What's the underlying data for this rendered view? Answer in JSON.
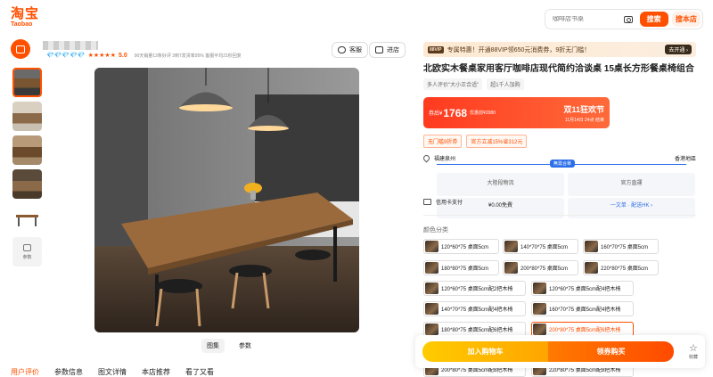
{
  "logo": {
    "cn": "淘宝",
    "en": "Taobao"
  },
  "search": {
    "placeholder": "咖啡店书桌",
    "search_btn": "搜索",
    "store_btn": "搜本店"
  },
  "shop": {
    "diamonds": "💎💎💎💎💎",
    "stars": "★★★★★",
    "score": "5.0",
    "stats": "90天销量13条好评  3到7发货率95%  客服平均21秒回复",
    "service": "客服",
    "enter": "进店"
  },
  "thumbs": {
    "param_label": "参数"
  },
  "image_tabs": [
    "图集",
    "参数"
  ],
  "bottom_tabs": [
    "用户评价",
    "参数信息",
    "图文详情",
    "本店推荐",
    "看了又看"
  ],
  "promo": {
    "vip": "88VIP",
    "text": "专属特惠！开通88VIP领650元消费券，9折无门槛！",
    "go": "去开通 ›"
  },
  "title": "北欧实木餐桌家用客厅咖啡店现代简约洽谈桌 15桌长方形餐桌椅组合",
  "tags": [
    "多人评价\"大小正合适\"",
    "超1千人加购"
  ],
  "price": {
    "label": "券后¥",
    "value": "1768",
    "orig": "优惠前¥2080",
    "event": "双11狂欢节",
    "date": "11月14日 24点 结束"
  },
  "coupons": [
    "无门槛9折券",
    "官方立减15%省312元"
  ],
  "shipping": {
    "from": "福建泉州",
    "to": "香港地區",
    "badge": "無需合單",
    "box1_title": "大陸段物流",
    "box1_value": "¥0.00免費",
    "box2_title": "官方直運",
    "box2_value": "一文单 · 配送HK ›"
  },
  "credit": "信用卡支付",
  "sku": {
    "label": "颜色分类",
    "items": [
      "120*60*75 桌面5cm",
      "140*70*75 桌面5cm",
      "160*70*75 桌面5cm",
      "180*80*75 桌面5cm",
      "200*80*75 桌面5cm",
      "220*80*75 桌面5cm",
      "120*60*75 桌面5cm配2把木椅",
      "120*60*75 桌面5cm配4把木椅",
      "140*70*75 桌面5cm配4把木椅",
      "160*70*75 桌面5cm配4把木椅",
      "180*80*75 桌面5cm配6把木椅",
      "200*80*75 桌面5cm配6把木椅",
      "200*80*75 桌面5cm配8把木椅",
      "220*80*75 桌面5cm配8把木椅"
    ]
  },
  "actions": {
    "cart": "加入购物车",
    "buy": "领券购买",
    "fav": "收藏"
  },
  "colors": {
    "accent": "#ff5000",
    "route": "#2b6ee9"
  }
}
